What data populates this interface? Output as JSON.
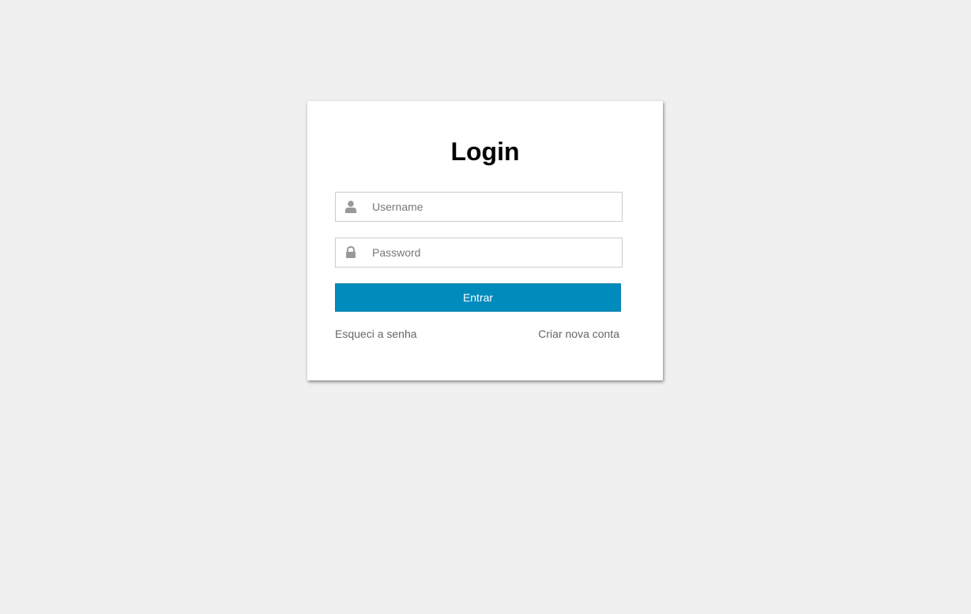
{
  "login": {
    "title": "Login",
    "username": {
      "placeholder": "Username",
      "value": "",
      "icon": "user-icon"
    },
    "password": {
      "placeholder": "Password",
      "value": "",
      "icon": "lock-icon"
    },
    "submit_label": "Entrar",
    "forgot_link": "Esqueci a senha",
    "create_link": "Criar nova conta"
  },
  "colors": {
    "background": "#f0f0f0",
    "card": "#ffffff",
    "primary_button": "#008bbd",
    "icon": "#999999",
    "link": "#666666"
  }
}
